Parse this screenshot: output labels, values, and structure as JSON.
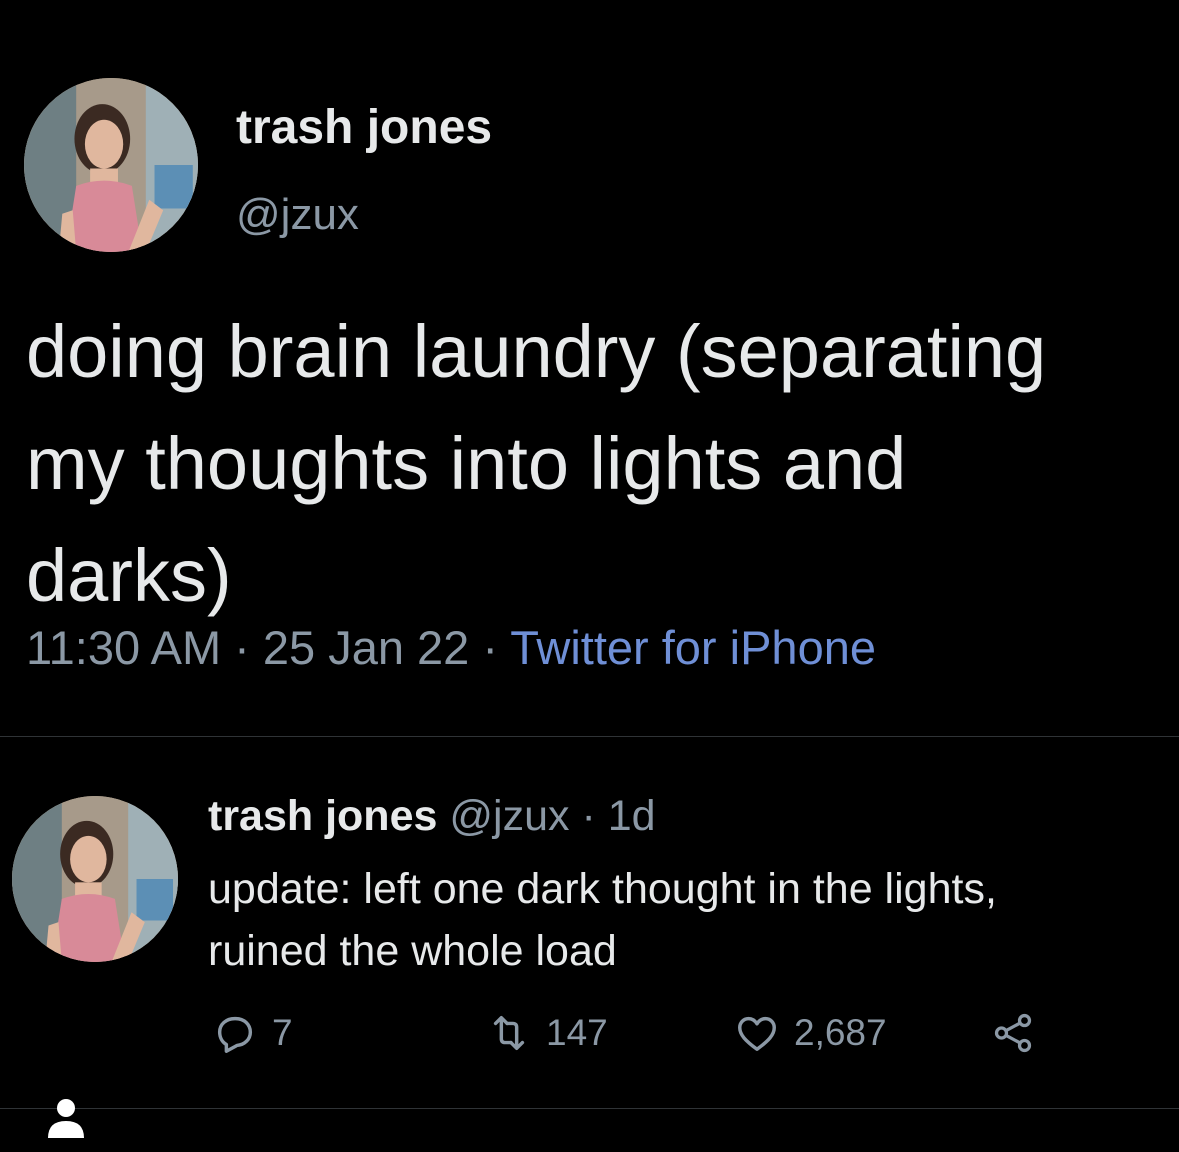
{
  "tweet": {
    "author_name": "trash jones",
    "author_handle": "@jzux",
    "text_lines": [
      "doing brain laundry (separating",
      "my thoughts into lights and",
      "darks)"
    ],
    "time": "11:30 AM",
    "separator": "·",
    "date": "25 Jan 22",
    "source": "Twitter for iPhone"
  },
  "reply": {
    "author_name": "trash jones",
    "author_handle": "@jzux",
    "separator": "·",
    "time_ago": "1d",
    "text_lines": [
      "update: left one dark thought in the lights,",
      "ruined the whole load"
    ],
    "actions": {
      "reply_count": "7",
      "retweet_count": "147",
      "like_count": "2,687"
    }
  },
  "icons": {
    "reply": "comment-icon",
    "retweet": "retweet-icon",
    "like": "heart-icon",
    "share": "share-icon",
    "bottom": "person-icon"
  },
  "colors": {
    "background": "#000000",
    "text_primary": "#e7e9ea",
    "text_secondary": "#8b98a5",
    "link": "#6f8fd6"
  }
}
